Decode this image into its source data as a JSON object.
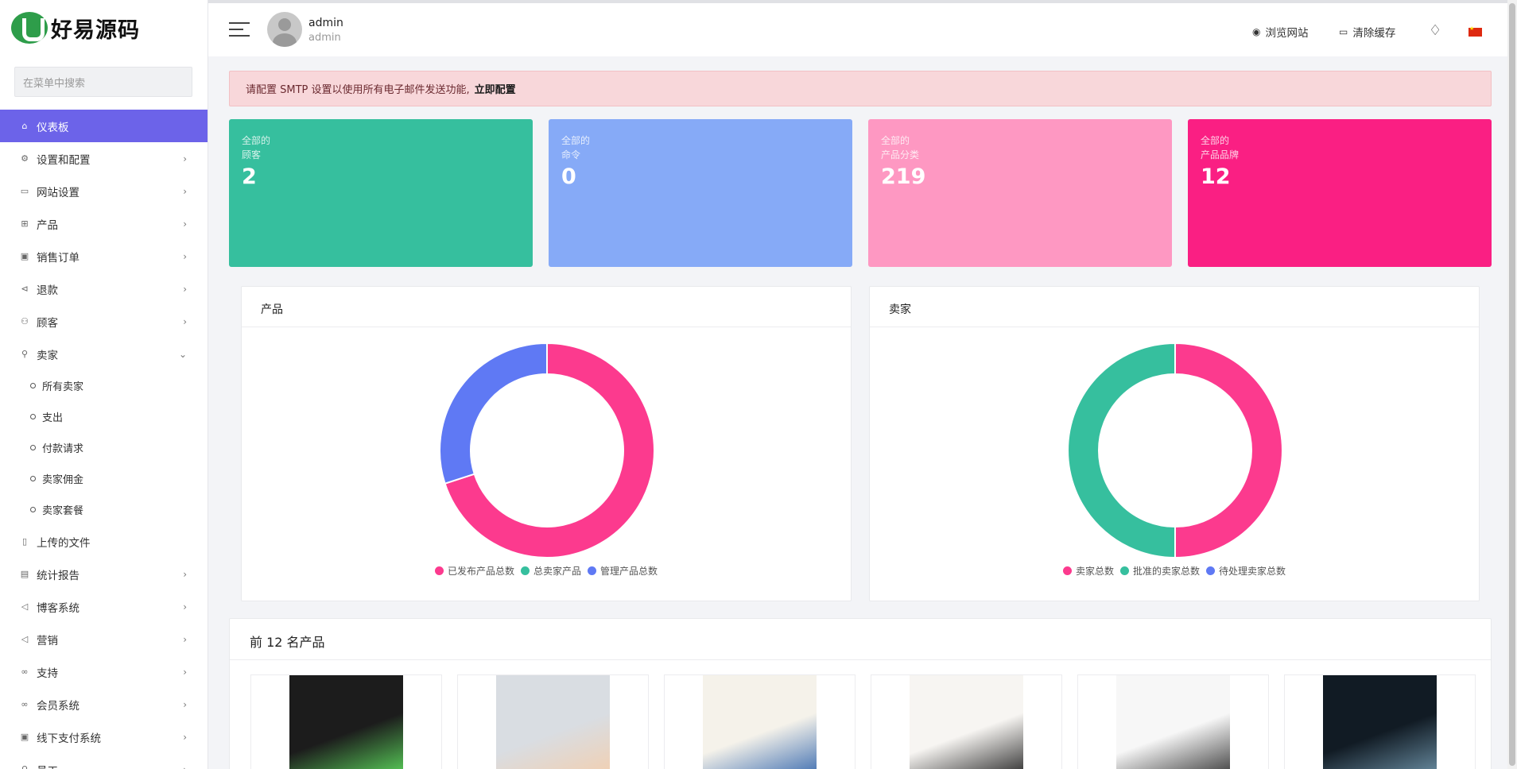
{
  "logo": {
    "text": "好易源码",
    "color": "#2e9d4a"
  },
  "search": {
    "placeholder": "在菜单中搜索"
  },
  "sidebar": {
    "items": [
      {
        "icon": "home-icon",
        "glyph": "⌂",
        "label": "仪表板",
        "active": true
      },
      {
        "icon": "gear-icon",
        "glyph": "⚙",
        "label": "设置和配置",
        "chevron": "›"
      },
      {
        "icon": "monitor-icon",
        "glyph": "▭",
        "label": "网站设置",
        "chevron": "›"
      },
      {
        "icon": "cart-icon",
        "glyph": "⊞",
        "label": "产品",
        "chevron": "›"
      },
      {
        "icon": "money-icon",
        "glyph": "▣",
        "label": "销售订单",
        "chevron": "›"
      },
      {
        "icon": "refund-icon",
        "glyph": "⊲",
        "label": "退款",
        "chevron": "›"
      },
      {
        "icon": "users-icon",
        "glyph": "⚇",
        "label": "顾客",
        "chevron": "›"
      },
      {
        "icon": "user-icon",
        "glyph": "⚲",
        "label": "卖家",
        "chevron": "⌄"
      }
    ],
    "sub_items": [
      "所有卖家",
      "支出",
      "付款请求",
      "卖家佣金",
      "卖家套餐"
    ],
    "items_after": [
      {
        "icon": "file-icon",
        "glyph": "▯",
        "label": "上传的文件"
      },
      {
        "icon": "report-icon",
        "glyph": "▤",
        "label": "统计报告",
        "chevron": "›"
      },
      {
        "icon": "megaphone-icon",
        "glyph": "◁",
        "label": "博客系统",
        "chevron": "›"
      },
      {
        "icon": "megaphone-icon",
        "glyph": "◁",
        "label": "营销",
        "chevron": "›"
      },
      {
        "icon": "link-icon",
        "glyph": "∞",
        "label": "支持",
        "chevron": "›"
      },
      {
        "icon": "link-icon",
        "glyph": "∞",
        "label": "会员系统",
        "chevron": "›"
      },
      {
        "icon": "cash-icon",
        "glyph": "▣",
        "label": "线下支付系统",
        "chevron": "›"
      },
      {
        "icon": "user-icon",
        "glyph": "⚲",
        "label": "员工",
        "chevron": "›"
      }
    ]
  },
  "header": {
    "user_name": "admin",
    "user_role": "admin",
    "visit_site": "浏览网站",
    "clear_cache": "清除缓存",
    "visit_icon": "◉",
    "cache_icon": "▭",
    "bell_icon": "🔔"
  },
  "alert": {
    "message": "请配置 SMTP 设置以使用所有电子邮件发送功能,",
    "link": "立即配置"
  },
  "stats": [
    {
      "label1": "全部的",
      "label2": "顾客",
      "value": "2",
      "color": "#36bf9e"
    },
    {
      "label1": "全部的",
      "label2": "命令",
      "value": "0",
      "color": "#86aaf7"
    },
    {
      "label1": "全部的",
      "label2": "产品分类",
      "value": "219",
      "color": "#fe98c2"
    },
    {
      "label1": "全部的",
      "label2": "产品品牌",
      "value": "12",
      "color": "#fa1f83"
    }
  ],
  "charts": {
    "products_title": "产品",
    "sellers_title": "卖家"
  },
  "chart_data": [
    {
      "type": "pie",
      "categories": [
        "已发布产品总数",
        "总卖家产品",
        "管理产品总数"
      ],
      "values": [
        70,
        0,
        30
      ],
      "colors": [
        "#fc3a8e",
        "#36bf9e",
        "#5f79f4"
      ]
    },
    {
      "type": "pie",
      "categories": [
        "卖家总数",
        "批准的卖家总数",
        "待处理卖家总数"
      ],
      "values": [
        50,
        50,
        0
      ],
      "colors": [
        "#fc3a8e",
        "#36bf9e",
        "#5f79f4"
      ]
    }
  ],
  "products": {
    "title": "前 12 名产品",
    "items": [
      {
        "icon": "pc-case-image",
        "bg": "#1c1c1c",
        "accent": "#5ad35a"
      },
      {
        "icon": "monitor-image",
        "bg": "#d9dde2",
        "accent": "#f2cfb0"
      },
      {
        "icon": "iphone-image",
        "bg": "#f5f2ea",
        "accent": "#3d6db0"
      },
      {
        "icon": "iphone-gold-image",
        "bg": "#f7f5f2",
        "accent": "#2a2a2a"
      },
      {
        "icon": "iphone-graphite-image",
        "bg": "#f7f7f7",
        "accent": "#3a3a3a"
      },
      {
        "icon": "iphone-wallpaper-image",
        "bg": "#111b24",
        "accent": "#6b8fa4"
      }
    ]
  }
}
